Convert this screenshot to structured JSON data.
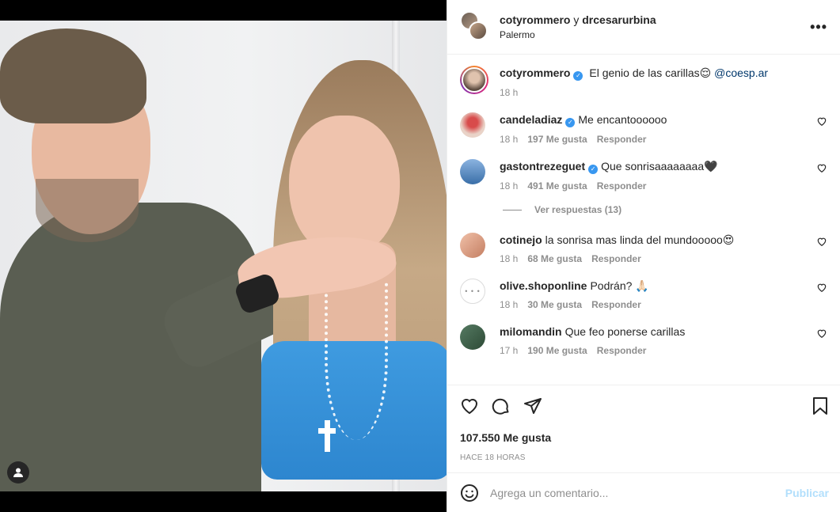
{
  "header": {
    "user1": "cotyrommero",
    "conjunction": "y",
    "user2": "drcesarurbina",
    "location": "Palermo",
    "more": "•••"
  },
  "caption": {
    "username": "cotyrommero",
    "text": "El genio de las carillas😌",
    "mention": "@coesp.ar",
    "time": "18 h"
  },
  "comments": [
    {
      "username": "candeladiaz",
      "verified": true,
      "text": "Me encantoooooo",
      "time": "18 h",
      "likes": "197 Me gusta",
      "reply": "Responder"
    },
    {
      "username": "gastontrezeguet",
      "verified": true,
      "text": "Que sonrisaaaaaaaa🖤",
      "time": "18 h",
      "likes": "491 Me gusta",
      "reply": "Responder"
    },
    {
      "username": "cotinejo",
      "verified": false,
      "text": "la sonrisa mas linda del mundooooo😍",
      "time": "18 h",
      "likes": "68 Me gusta",
      "reply": "Responder"
    },
    {
      "username": "olive.shoponline",
      "verified": false,
      "text": "Podrán? 🙏🏻",
      "time": "18 h",
      "likes": "30 Me gusta",
      "reply": "Responder"
    },
    {
      "username": "milomandin",
      "verified": false,
      "text": "Que feo ponerse carillas",
      "time": "17 h",
      "likes": "190 Me gusta",
      "reply": "Responder"
    }
  ],
  "view_replies": "Ver respuestas (13)",
  "verified_mark": "✓",
  "olive_avatar": "• • •",
  "likes_total": "107.550 Me gusta",
  "posted": "HACE 18 HORAS",
  "add_comment": {
    "placeholder": "Agrega un comentario...",
    "post": "Publicar"
  },
  "colors": {
    "accent": "#3897f0",
    "link": "#00376b",
    "publish_disabled": "#b2dffc",
    "secondary_text": "#8e8e8e"
  }
}
